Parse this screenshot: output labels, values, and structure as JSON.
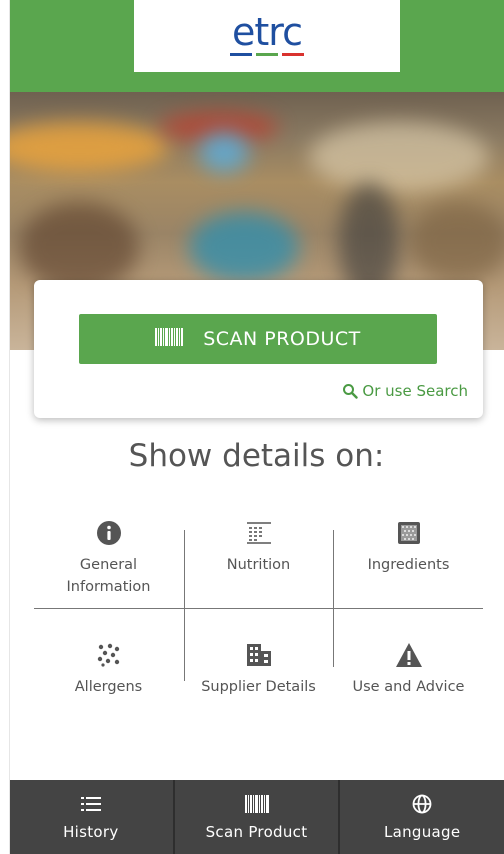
{
  "header": {
    "logo_text": "etrc",
    "logo_bar_colors": [
      "#1f4fa0",
      "#5aa64e",
      "#d9322e"
    ],
    "accent_color": "#5aa64e"
  },
  "hero": {
    "image": "blurred-retail-store-photo"
  },
  "scan_card": {
    "scan_button_label": "SCAN PRODUCT",
    "scan_button_icon": "barcode-icon",
    "search_link_label": "Or use Search",
    "search_link_icon": "search-icon"
  },
  "details": {
    "title": "Show details on:",
    "items": [
      {
        "label": "General Information",
        "icon": "info-icon"
      },
      {
        "label": "Nutrition",
        "icon": "nutrition-table-icon"
      },
      {
        "label": "Ingredients",
        "icon": "ingredients-icon"
      },
      {
        "label": "Allergens",
        "icon": "allergens-dots-icon"
      },
      {
        "label": "Supplier Details",
        "icon": "building-icon"
      },
      {
        "label": "Use and Advice",
        "icon": "warning-icon"
      }
    ]
  },
  "bottom_nav": {
    "items": [
      {
        "label": "History",
        "icon": "list-icon"
      },
      {
        "label": "Scan Product",
        "icon": "barcode-icon"
      },
      {
        "label": "Language",
        "icon": "globe-icon"
      }
    ]
  }
}
